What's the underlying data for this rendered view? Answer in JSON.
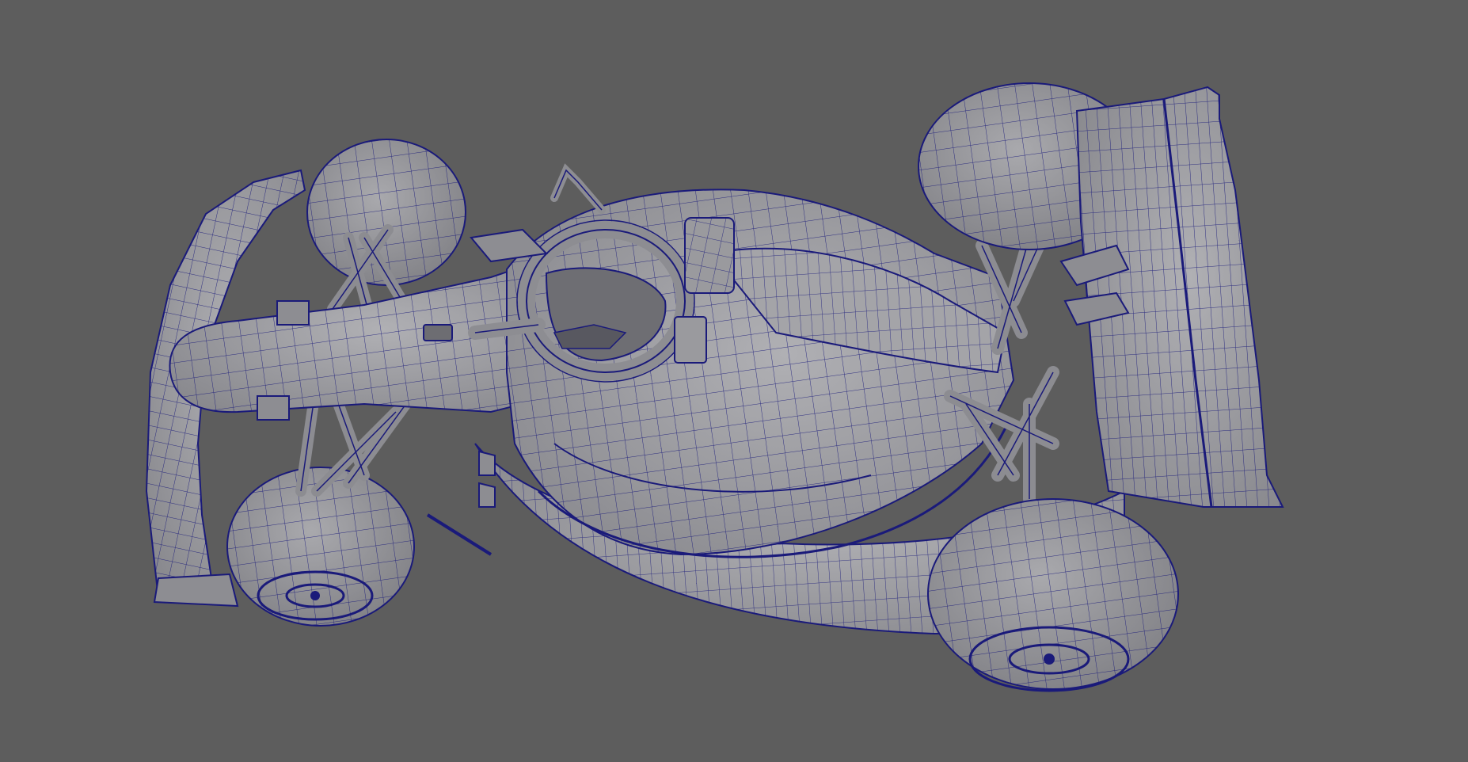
{
  "viewport": {
    "background_color": "#5d5d5d",
    "mesh_fill_color": "#9b9b9f",
    "mesh_shade_color": "#7d7d82",
    "wireframe_color": "#1a1a7a"
  },
  "scene": {
    "object": "formula-one-car-polygon-model",
    "display_mode": "wireframe-on-shaded",
    "parts": [
      "front-wing-icon",
      "front-left-tyre-icon",
      "front-right-tyre-icon",
      "nose-cone-icon",
      "halo-icon",
      "cockpit-icon",
      "mirror-icon",
      "airbox-icon",
      "engine-cover-icon",
      "sidepod-icon",
      "floor-icon",
      "rear-left-tyre-icon",
      "rear-right-tyre-icon",
      "rear-wing-icon",
      "suspension-icon"
    ]
  }
}
